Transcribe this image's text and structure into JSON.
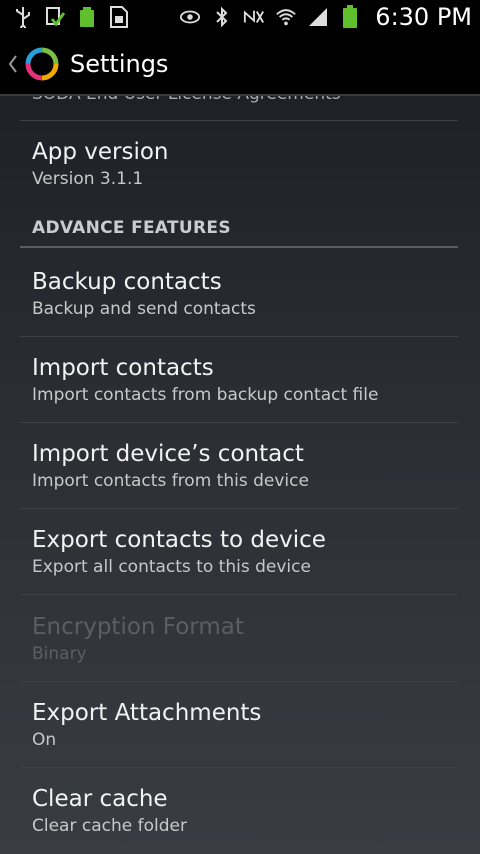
{
  "status_bar": {
    "time": "6:30 PM",
    "left_icons": [
      "usb-icon",
      "download-done-icon",
      "battery-app-icon",
      "sim-card-icon"
    ],
    "right_icons": [
      "eye-icon",
      "bluetooth-icon",
      "no-mute-icon",
      "wifi-icon",
      "signal-icon",
      "battery-icon"
    ]
  },
  "action_bar": {
    "title": "Settings"
  },
  "clipped_item": {
    "title": "SODA End User License Agreements"
  },
  "items_top": [
    {
      "title": "App version",
      "subtitle": "Version 3.1.1"
    }
  ],
  "section": {
    "label": "ADVANCE FEATURES"
  },
  "items": [
    {
      "title": "Backup contacts",
      "subtitle": "Backup and send contacts",
      "enabled": true
    },
    {
      "title": "Import contacts",
      "subtitle": "Import contacts from backup contact file",
      "enabled": true
    },
    {
      "title": "Import device’s contact",
      "subtitle": "Import contacts from this device",
      "enabled": true
    },
    {
      "title": "Export contacts to device",
      "subtitle": "Export all contacts to this device",
      "enabled": true
    },
    {
      "title": "Encryption Format",
      "subtitle": "Binary",
      "enabled": false
    },
    {
      "title": "Export Attachments",
      "subtitle": "On",
      "enabled": true
    },
    {
      "title": "Clear cache",
      "subtitle": "Clear cache folder",
      "enabled": true
    }
  ],
  "colors": {
    "accent_green": "#5fbf2c",
    "background_top": "#1e2227",
    "background_bottom": "#393d42"
  }
}
